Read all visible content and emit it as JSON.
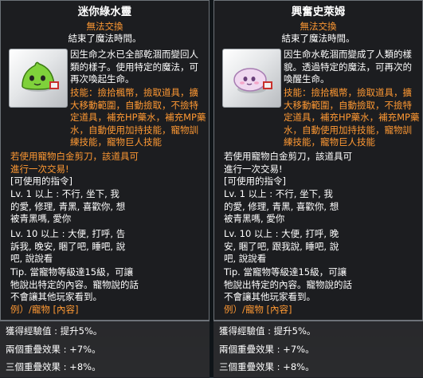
{
  "left": {
    "title": "迷你綠水靈",
    "trade": "無法交換",
    "expired": "結束了魔法時間。",
    "desc": "因生命之水已全部乾涸而變回人\n類的樣子。使用特定的魔法，可\n再次喚起生命。",
    "skills": "技能：撿拾楓幣，撿取道具，擴\n大移動範圍，自動撿取，不撿特\n定道具，補充HP藥水，補充MP藥\n水，自動使用加持技能，寵物訓\n練技能，寵物巨人技能",
    "warn": "若使用寵物白金剪刀，該道具可\n進行一次交易!",
    "cmd_title": "[可使用的指令]",
    "cmd1": "Lv. 1 以上 : 不行, 坐下, 我\n的愛, 修理, 青黑, 喜歡你, 想\n被青黑嗎, 愛你",
    "cmd2": "Lv. 10 以上 : 大便, 打呼, 告\n訴我, 晚安, 睏了吧, 睡吧, 說\n吧, 說說看",
    "tip": "Tip. 當寵物等級達15級，可讓\n牠說出特定的內容。寵物說的話\n不會讓其他玩家看到。",
    "example": "例）/寵物 [內容]",
    "bottom": [
      "獲得經驗值 : 提升5%。",
      "兩個重疊效果 : +7%。",
      "三個重疊效果 : +8%。"
    ]
  },
  "right": {
    "title": "興奮史萊姆",
    "trade": "無法交換",
    "expired": "結束了魔法時間。",
    "desc": "因生命水乾涸而變成了人類的樣\n貌。透過特定的魔法，可再次的\n喚醒生命。",
    "skills": "技能：撿拾楓幣，撿取道具，擴\n大移動範圍，自動撿取，不撿特\n定道具，補充HP藥水，補充MP藥\n水，自動使用加持技能，寵物訓\n練技能，寵物巨人技能",
    "warn": "若使用寵物白金剪刀，該道具可\n進行一次交易!",
    "cmd_title": "[可使用的指令]",
    "cmd1": "Lv. 1 以上 : 不行, 坐下, 我\n的愛, 修理, 青黑, 喜歡你, 想\n被青黑嗎, 愛你",
    "cmd2": "Lv. 10 以上 : 大便, 打呼, 晚\n安, 睏了吧, 跟我說, 睡吧, 說\n吧, 說說看",
    "tip": "Tip. 當寵物等級達15級，可讓\n牠說出特定的內容。寵物說的話\n不會讓其他玩家看到。",
    "example": "例）/寵物 [內容]",
    "bottom": [
      "獲得經驗值 : 提升5%。",
      "兩個重疊效果 : +7%。",
      "三個重疊效果 : +8%。"
    ]
  },
  "icons": {
    "left": "green-slime-pet-icon",
    "right": "pink-slime-pet-icon"
  },
  "colors": {
    "accent": "#ff9933",
    "panel": "#1c1d20"
  }
}
